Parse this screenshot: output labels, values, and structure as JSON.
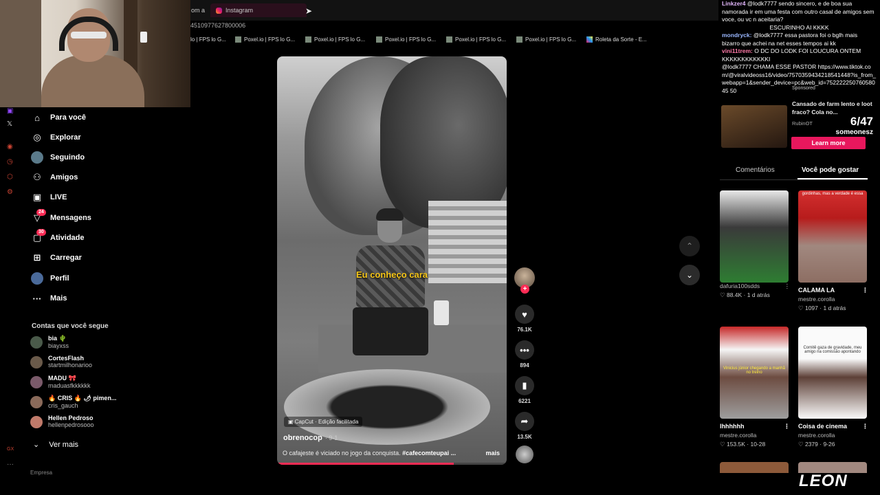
{
  "browser": {
    "tab_prev": "om a",
    "tab_active": "Instagram",
    "url": "4510977627800006",
    "bookmarks": [
      "lo | FPS lo G...",
      "Poxel.io | FPS lo G...",
      "Poxel.io | FPS lo G...",
      "Poxel.io | FPS lo G...",
      "Poxel.io | FPS lo G...",
      "Poxel.io | FPS lo G..."
    ],
    "bookmark_roleta": "Roleta da Sorte - E..."
  },
  "nav": {
    "items": [
      {
        "label": "Para você",
        "icon": "⌂"
      },
      {
        "label": "Explorar",
        "icon": "◎"
      },
      {
        "label": "Seguindo",
        "icon": "●"
      },
      {
        "label": "Amigos",
        "icon": "⚇"
      },
      {
        "label": "LIVE",
        "icon": "▣"
      },
      {
        "label": "Mensagens",
        "icon": "▽",
        "badge": "24"
      },
      {
        "label": "Atividade",
        "icon": "▢",
        "badge": "30"
      },
      {
        "label": "Carregar",
        "icon": "⊞"
      },
      {
        "label": "Perfil",
        "icon": "●"
      },
      {
        "label": "Mais",
        "icon": "···"
      }
    ],
    "following_heading": "Contas que você segue",
    "accounts": [
      {
        "name": "bia 🌵",
        "handle": "biayxss"
      },
      {
        "name": "CortesFlash",
        "handle": "startmilhonarioo"
      },
      {
        "name": "MADU 🎀",
        "handle": "maduasfkkkkkk"
      },
      {
        "name": "🔥 CRIS 🔥 🌶 pimen...",
        "handle": "cris_gauch"
      },
      {
        "name": "Hellen Pedroso",
        "handle": "hellenpedrosooo"
      }
    ],
    "see_more": "Ver mais",
    "company": "Empresa"
  },
  "video": {
    "caption_overlay": "Eu conheço cara",
    "capcut": "CapCut · Edição facilitada",
    "author": "obrenocop",
    "date": "· 9-1",
    "description": "O cafajeste é viciado no jogo da conquista. ",
    "hashtag": "#cafecomteupai ...",
    "more": "mais",
    "progress": 0.77
  },
  "actions": {
    "likes": "76.1K",
    "comments": "894",
    "saves": "6221",
    "shares": "13.5K"
  },
  "chat": [
    {
      "user": "Linkzer4",
      "text": "@lodk7777 sendo sincero, e de boa sua namorada ir em uma festa com outro casal de amigos sem voce, ou vc n aceitaria?",
      "cls": "u1"
    },
    {
      "user": "",
      "text": "ESCURINHO AI KKKK",
      "cls": "u2"
    },
    {
      "user": "mondryck:",
      "text": "@lodk7777 essa pastora foi o bglh mais bizarro que achei na net esses tempos ai kk",
      "cls": "u2"
    },
    {
      "user": "vini11trem:",
      "text": "O DC DO LODK FOI LOUCURA ONTEM KKKKKKKKKKKKI",
      "cls": "u3"
    },
    {
      "user": "",
      "text": "@lodk7777 CHAMA ESSE PASTOR https://www.tiktok.com/@viralvideoss16/video/7570359434218541448?is_from_webapp=1&sender_device=pc&web_id=75222225076058045 50",
      "cls": "u4"
    }
  ],
  "ad": {
    "sponsored": "Sponsored",
    "title": "Cansado de farm lento e loot fraco? Cola no...",
    "brand": "RubinOT",
    "counter": "6/47",
    "name": "someonesz",
    "cta": "Learn more"
  },
  "right_tabs": {
    "comments": "Comentários",
    "may_like": "Você pode gostar"
  },
  "cards": [
    {
      "title": "",
      "user": "dafuria100sdds",
      "stats": "♡ 88.4K · 1 d atrás",
      "top": ""
    },
    {
      "title": "CALAMA LA",
      "user": "mestre.corolla",
      "stats": "♡ 1097 · 1 d atrás",
      "top": "gordinhas, mas a verdade é essa"
    },
    {
      "title": "lhhhhhh",
      "user": "mestre.corolla",
      "stats": "♡ 153.5K · 10-28",
      "top": "Vinicius júnior chegando a manhã no treino"
    },
    {
      "title": "Coisa de cinema",
      "user": "mestre.corolla",
      "stats": "♡ 2379 · 9-26",
      "top": "Comitê gaza de gravidade, meu amigo na comissão apontando"
    }
  ],
  "overlay_brand": "LEON",
  "colors": {
    "accent": "#fe2c55",
    "caption": "#f5c518",
    "ad_button": "#e8175d"
  }
}
